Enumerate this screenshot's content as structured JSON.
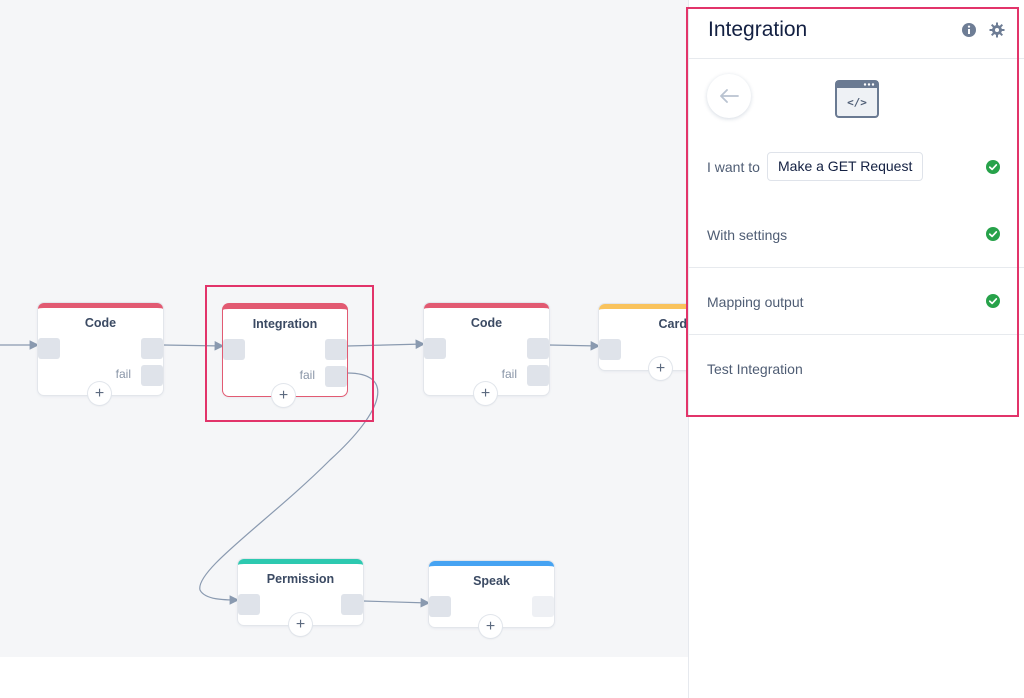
{
  "canvas": {
    "blocks": [
      {
        "id": "code1",
        "title": "Code",
        "accent": "#e25a72",
        "fail_label": "fail"
      },
      {
        "id": "integration",
        "title": "Integration",
        "accent": "#e25a72",
        "fail_label": "fail",
        "selected": true
      },
      {
        "id": "code2",
        "title": "Code",
        "accent": "#e25a72",
        "fail_label": "fail"
      },
      {
        "id": "card",
        "title": "Card",
        "accent": "#f9c35d"
      },
      {
        "id": "permission",
        "title": "Permission",
        "accent": "#2dc9b0"
      },
      {
        "id": "speak",
        "title": "Speak",
        "accent": "#46a3f2"
      }
    ],
    "add_symbol": "+"
  },
  "panel": {
    "title": "Integration",
    "header_icons": [
      "info-icon",
      "gear-icon"
    ],
    "back_icon": "arrow-left-icon",
    "main_icon": "code-window-icon",
    "main_icon_text": "</>",
    "action_prefix": "I want to",
    "action_value": "Make a GET Request",
    "rows": [
      {
        "label": "With settings",
        "complete": true
      },
      {
        "label": "Mapping output",
        "complete": true
      },
      {
        "label": "Test Integration",
        "complete": false
      }
    ],
    "action_complete": true
  },
  "colors": {
    "highlight": "#e2346a",
    "check": "#27a24a",
    "canvas_bg": "#f5f6f8"
  }
}
